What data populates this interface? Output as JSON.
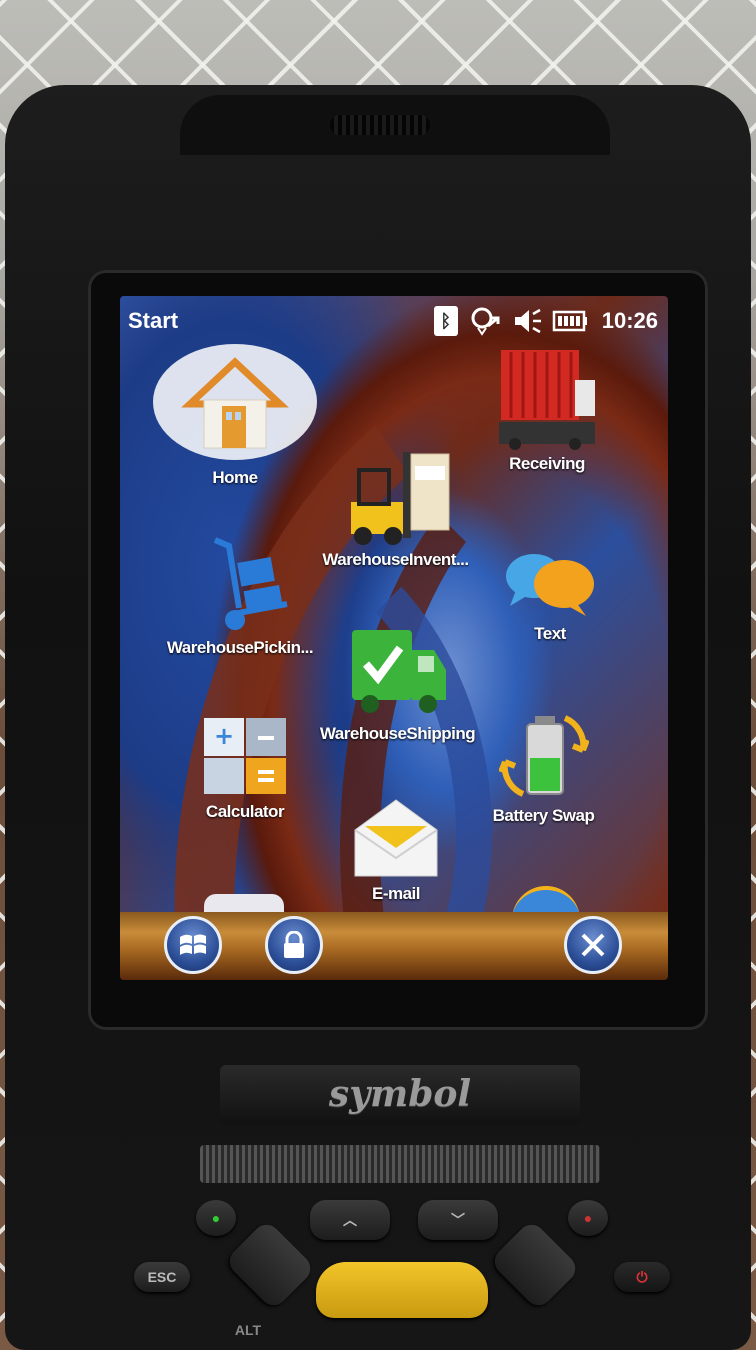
{
  "status_bar": {
    "start_label": "Start",
    "time": "10:26",
    "icons": [
      "bluetooth-icon",
      "connectivity-icon",
      "volume-muted-icon",
      "battery-icon"
    ]
  },
  "tiles": [
    {
      "id": "home",
      "label": "Home",
      "icon": "house-icon"
    },
    {
      "id": "receiving",
      "label": "Receiving",
      "icon": "shipping-container-icon"
    },
    {
      "id": "warehouse-inventory",
      "label": "WarehouseInvent...",
      "icon": "forklift-icon"
    },
    {
      "id": "warehouse-picking",
      "label": "WarehousePickin...",
      "icon": "hand-truck-icon"
    },
    {
      "id": "text",
      "label": "Text",
      "icon": "speech-bubbles-icon"
    },
    {
      "id": "warehouse-shipping",
      "label": "WarehouseShipping",
      "icon": "delivery-truck-check-icon"
    },
    {
      "id": "calculator",
      "label": "Calculator",
      "icon": "calculator-icon"
    },
    {
      "id": "battery-swap",
      "label": "Battery Swap",
      "icon": "battery-swap-icon"
    },
    {
      "id": "email",
      "label": "E-mail",
      "icon": "envelope-icon"
    }
  ],
  "softbar": {
    "buttons": [
      "windows-start-icon",
      "lock-icon",
      "close-icon"
    ]
  },
  "device": {
    "brand": "symbol",
    "keys": {
      "esc": "ESC",
      "alt": "ALT"
    }
  },
  "colors": {
    "accent_blue": "#2c4f98",
    "wallpaper_brown": "#7a2f1a",
    "softbar_gold": "#c98c3a",
    "enter_key_yellow": "#f3c52a"
  }
}
